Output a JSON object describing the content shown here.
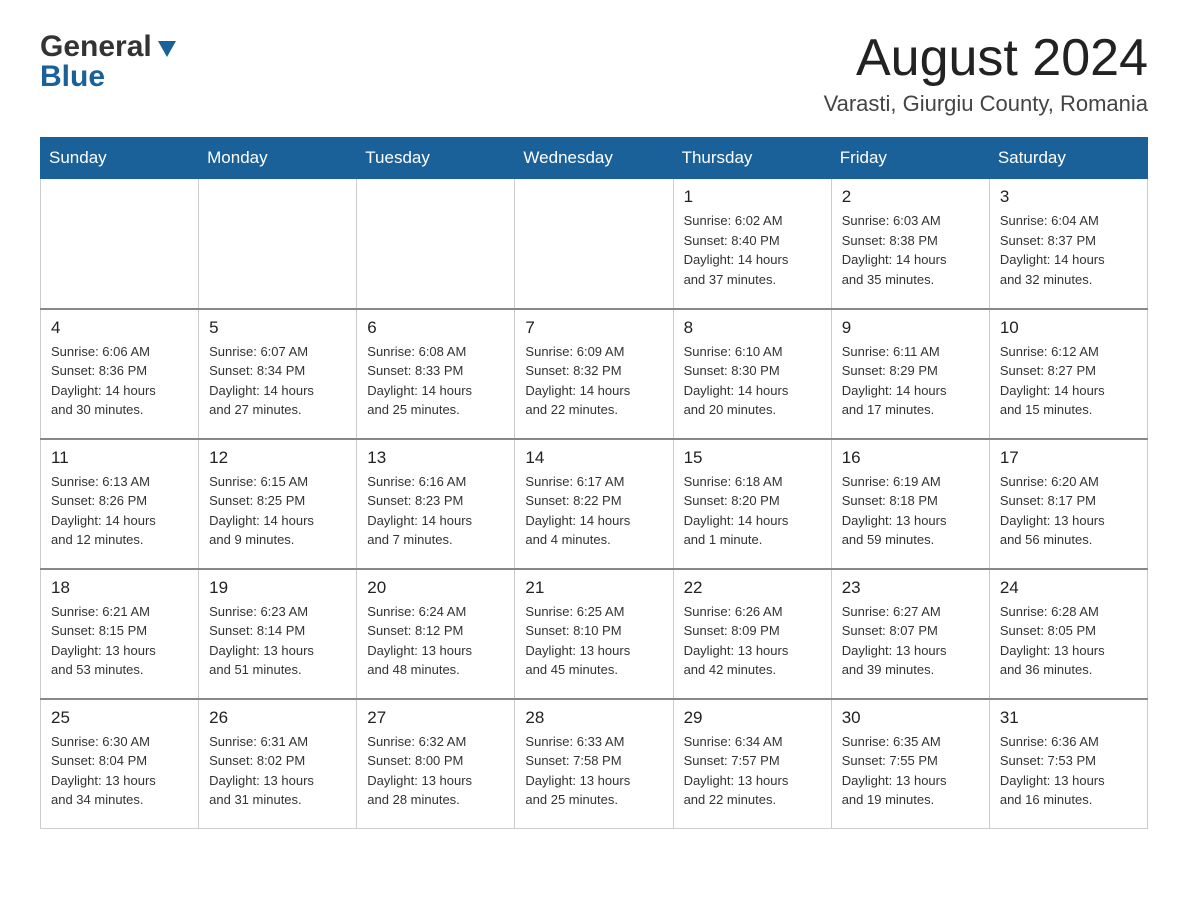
{
  "header": {
    "logo_general": "General",
    "logo_arrow": "▶",
    "logo_blue": "Blue",
    "month_title": "August 2024",
    "location": "Varasti, Giurgiu County, Romania"
  },
  "weekdays": [
    "Sunday",
    "Monday",
    "Tuesday",
    "Wednesday",
    "Thursday",
    "Friday",
    "Saturday"
  ],
  "weeks": [
    [
      {
        "day": "",
        "info": ""
      },
      {
        "day": "",
        "info": ""
      },
      {
        "day": "",
        "info": ""
      },
      {
        "day": "",
        "info": ""
      },
      {
        "day": "1",
        "info": "Sunrise: 6:02 AM\nSunset: 8:40 PM\nDaylight: 14 hours\nand 37 minutes."
      },
      {
        "day": "2",
        "info": "Sunrise: 6:03 AM\nSunset: 8:38 PM\nDaylight: 14 hours\nand 35 minutes."
      },
      {
        "day": "3",
        "info": "Sunrise: 6:04 AM\nSunset: 8:37 PM\nDaylight: 14 hours\nand 32 minutes."
      }
    ],
    [
      {
        "day": "4",
        "info": "Sunrise: 6:06 AM\nSunset: 8:36 PM\nDaylight: 14 hours\nand 30 minutes."
      },
      {
        "day": "5",
        "info": "Sunrise: 6:07 AM\nSunset: 8:34 PM\nDaylight: 14 hours\nand 27 minutes."
      },
      {
        "day": "6",
        "info": "Sunrise: 6:08 AM\nSunset: 8:33 PM\nDaylight: 14 hours\nand 25 minutes."
      },
      {
        "day": "7",
        "info": "Sunrise: 6:09 AM\nSunset: 8:32 PM\nDaylight: 14 hours\nand 22 minutes."
      },
      {
        "day": "8",
        "info": "Sunrise: 6:10 AM\nSunset: 8:30 PM\nDaylight: 14 hours\nand 20 minutes."
      },
      {
        "day": "9",
        "info": "Sunrise: 6:11 AM\nSunset: 8:29 PM\nDaylight: 14 hours\nand 17 minutes."
      },
      {
        "day": "10",
        "info": "Sunrise: 6:12 AM\nSunset: 8:27 PM\nDaylight: 14 hours\nand 15 minutes."
      }
    ],
    [
      {
        "day": "11",
        "info": "Sunrise: 6:13 AM\nSunset: 8:26 PM\nDaylight: 14 hours\nand 12 minutes."
      },
      {
        "day": "12",
        "info": "Sunrise: 6:15 AM\nSunset: 8:25 PM\nDaylight: 14 hours\nand 9 minutes."
      },
      {
        "day": "13",
        "info": "Sunrise: 6:16 AM\nSunset: 8:23 PM\nDaylight: 14 hours\nand 7 minutes."
      },
      {
        "day": "14",
        "info": "Sunrise: 6:17 AM\nSunset: 8:22 PM\nDaylight: 14 hours\nand 4 minutes."
      },
      {
        "day": "15",
        "info": "Sunrise: 6:18 AM\nSunset: 8:20 PM\nDaylight: 14 hours\nand 1 minute."
      },
      {
        "day": "16",
        "info": "Sunrise: 6:19 AM\nSunset: 8:18 PM\nDaylight: 13 hours\nand 59 minutes."
      },
      {
        "day": "17",
        "info": "Sunrise: 6:20 AM\nSunset: 8:17 PM\nDaylight: 13 hours\nand 56 minutes."
      }
    ],
    [
      {
        "day": "18",
        "info": "Sunrise: 6:21 AM\nSunset: 8:15 PM\nDaylight: 13 hours\nand 53 minutes."
      },
      {
        "day": "19",
        "info": "Sunrise: 6:23 AM\nSunset: 8:14 PM\nDaylight: 13 hours\nand 51 minutes."
      },
      {
        "day": "20",
        "info": "Sunrise: 6:24 AM\nSunset: 8:12 PM\nDaylight: 13 hours\nand 48 minutes."
      },
      {
        "day": "21",
        "info": "Sunrise: 6:25 AM\nSunset: 8:10 PM\nDaylight: 13 hours\nand 45 minutes."
      },
      {
        "day": "22",
        "info": "Sunrise: 6:26 AM\nSunset: 8:09 PM\nDaylight: 13 hours\nand 42 minutes."
      },
      {
        "day": "23",
        "info": "Sunrise: 6:27 AM\nSunset: 8:07 PM\nDaylight: 13 hours\nand 39 minutes."
      },
      {
        "day": "24",
        "info": "Sunrise: 6:28 AM\nSunset: 8:05 PM\nDaylight: 13 hours\nand 36 minutes."
      }
    ],
    [
      {
        "day": "25",
        "info": "Sunrise: 6:30 AM\nSunset: 8:04 PM\nDaylight: 13 hours\nand 34 minutes."
      },
      {
        "day": "26",
        "info": "Sunrise: 6:31 AM\nSunset: 8:02 PM\nDaylight: 13 hours\nand 31 minutes."
      },
      {
        "day": "27",
        "info": "Sunrise: 6:32 AM\nSunset: 8:00 PM\nDaylight: 13 hours\nand 28 minutes."
      },
      {
        "day": "28",
        "info": "Sunrise: 6:33 AM\nSunset: 7:58 PM\nDaylight: 13 hours\nand 25 minutes."
      },
      {
        "day": "29",
        "info": "Sunrise: 6:34 AM\nSunset: 7:57 PM\nDaylight: 13 hours\nand 22 minutes."
      },
      {
        "day": "30",
        "info": "Sunrise: 6:35 AM\nSunset: 7:55 PM\nDaylight: 13 hours\nand 19 minutes."
      },
      {
        "day": "31",
        "info": "Sunrise: 6:36 AM\nSunset: 7:53 PM\nDaylight: 13 hours\nand 16 minutes."
      }
    ]
  ]
}
